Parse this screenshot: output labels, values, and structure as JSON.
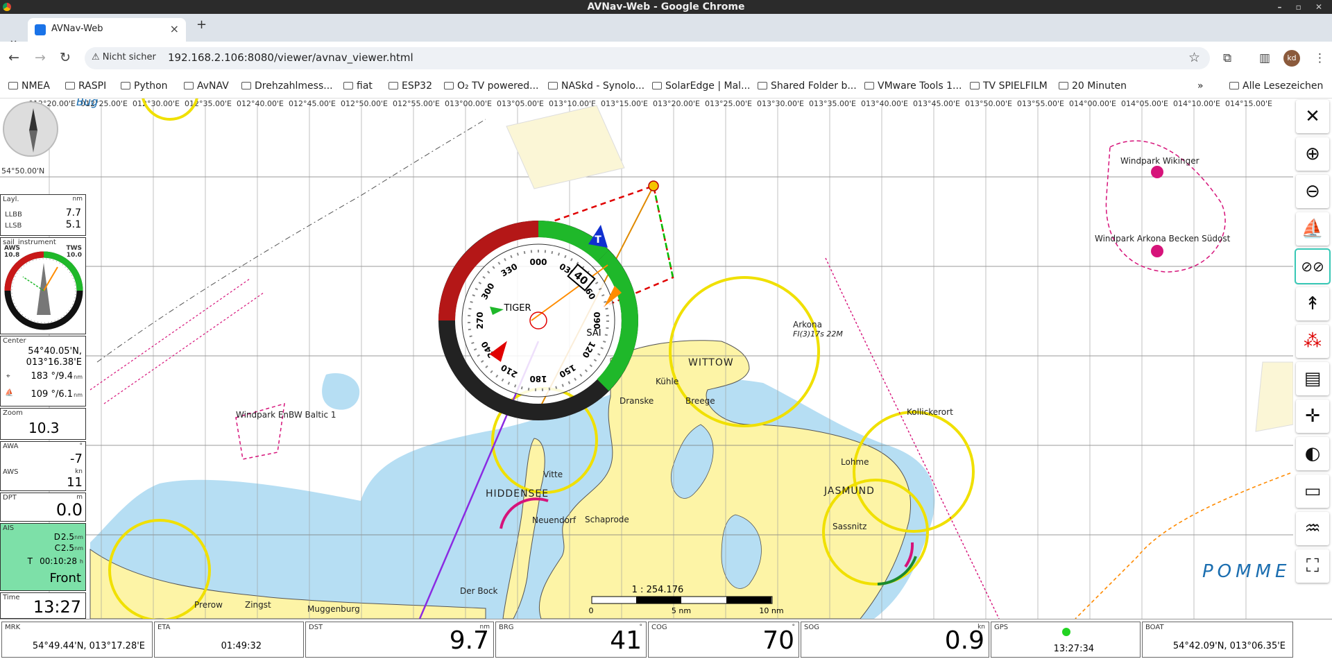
{
  "window": {
    "title": "AVNav-Web - Google Chrome"
  },
  "tab": {
    "title": "AVNav-Web"
  },
  "address": {
    "security": "Nicht sicher",
    "url": "192.168.2.106:8080/viewer/avnav_viewer.html"
  },
  "bookmarks": [
    "NMEA",
    "RASPI",
    "Python",
    "AvNAV",
    "Drehzahlmess...",
    "fiat",
    "ESP32",
    "O₂ TV powered...",
    "NASkd - Synolo...",
    "SolarEdge | Mal...",
    "Shared Folder b...",
    "VMware Tools 1...",
    "TV SPIELFILM",
    "20 Minuten"
  ],
  "bookmarks_all": "Alle Lesezeichen",
  "map": {
    "longitudes": [
      "012°20.00'E",
      "012°25.00'E",
      "012°30.00'E",
      "012°35.00'E",
      "012°40.00'E",
      "012°45.00'E",
      "012°50.00'E",
      "012°55.00'E",
      "013°00.00'E",
      "013°05.00'E",
      "013°10.00'E",
      "013°15.00'E",
      "013°20.00'E",
      "013°25.00'E",
      "013°30.00'E",
      "013°35.00'E",
      "013°40.00'E",
      "013°45.00'E",
      "013°50.00'E",
      "013°55.00'E",
      "014°00.00'E",
      "014°05.00'E",
      "014°10.00'E",
      "014°15.00'E"
    ],
    "lat_label": "54°50.00'N",
    "scale_text": "1 : 254.176",
    "scale_labels": [
      "0",
      "5 nm",
      "10 nm"
    ],
    "labels": {
      "windpark_wikinger": "Windpark Wikinger",
      "windpark_arkona": "Windpark Arkona Becken Südost",
      "arkona": "Arkona",
      "arkona_light": "FI(3)17s 22M",
      "wittow": "WITTOW",
      "jasmund": "JASMUND",
      "hiddensee": "HIDDENSEE",
      "pommern": "POMME",
      "kollicker": "Kollickerort",
      "windpark_baltic": "Windpark EnBW Baltic 1",
      "tiger": "TIGER",
      "bug": "Bug",
      "kuhle": "Kühle",
      "dranske": "Dranske",
      "breege": "Breege",
      "vitte": "Vitte",
      "neuendorf": "Neuendorf",
      "schaprode": "Schaprode",
      "lohme": "Lohme",
      "sassnitz": "Sassnitz",
      "prerow": "Prerow",
      "zingst": "Zingst",
      "muggenburg": "Muggenburg",
      "der_bock": "Der Bock"
    }
  },
  "widgets": {
    "layline": {
      "caption": "Layl.",
      "unit": "nm",
      "rows": [
        {
          "label": "LLBB",
          "value": "7.7"
        },
        {
          "label": "LLSB",
          "value": "5.1"
        }
      ]
    },
    "sail": {
      "caption": "sail_instrument",
      "aws_label": "AWS",
      "aws": "10.8",
      "tws_label": "TWS",
      "tws": "10.0"
    },
    "center": {
      "caption": "Center",
      "lat": "54°40.05'N,",
      "lon": "013°16.38'E",
      "row1": "183 °/9.4",
      "row1_unit": "nm",
      "row2": "109 °/6.1",
      "row2_unit": "nm"
    },
    "zoom": {
      "caption": "Zoom",
      "value": "10.3"
    },
    "wind": {
      "awa_label": "AWA",
      "awa_unit": "°",
      "awa": "-7",
      "aws_label": "AWS",
      "aws_unit": "kn",
      "aws": "11"
    },
    "dpt": {
      "caption": "DPT",
      "unit": "m",
      "value": "0.0"
    },
    "ais": {
      "caption": "AIS",
      "d_label": "D",
      "d": "2.5",
      "d_unit": "nm",
      "c_label": "C",
      "c": "2.5",
      "c_unit": "nm",
      "t_label": "T",
      "t": "00:10:28",
      "t_unit": "h",
      "front": "Front",
      "color": "#7de0a8"
    },
    "time": {
      "caption": "Time",
      "value": "13:27"
    }
  },
  "compass": {
    "labels": [
      "000",
      "030",
      "060",
      "090",
      "120",
      "150",
      "180",
      "210",
      "240",
      "270",
      "300",
      "330"
    ],
    "speed": "40",
    "true_label": "T",
    "sai": "SAI"
  },
  "bottom": {
    "mrk": {
      "caption": "MRK",
      "value": "54°49.44'N, 013°17.28'E"
    },
    "eta": {
      "caption": "ETA",
      "value": "01:49:32"
    },
    "dst": {
      "caption": "DST",
      "unit": "nm",
      "value": "9.7"
    },
    "brg": {
      "caption": "BRG",
      "unit": "°",
      "value": "41"
    },
    "cog": {
      "caption": "COG",
      "unit": "°",
      "value": "70"
    },
    "sog": {
      "caption": "SOG",
      "unit": "kn",
      "value": "0.9"
    },
    "gps": {
      "caption": "GPS",
      "value": "13:27:34"
    },
    "boat": {
      "caption": "BOAT",
      "value": "54°42.09'N, 013°06.35'E"
    }
  },
  "colors": {
    "land": "#fdf4a6",
    "shallow": "#b6def3",
    "deep": "#ffffff",
    "accent": "#38c8b6"
  }
}
